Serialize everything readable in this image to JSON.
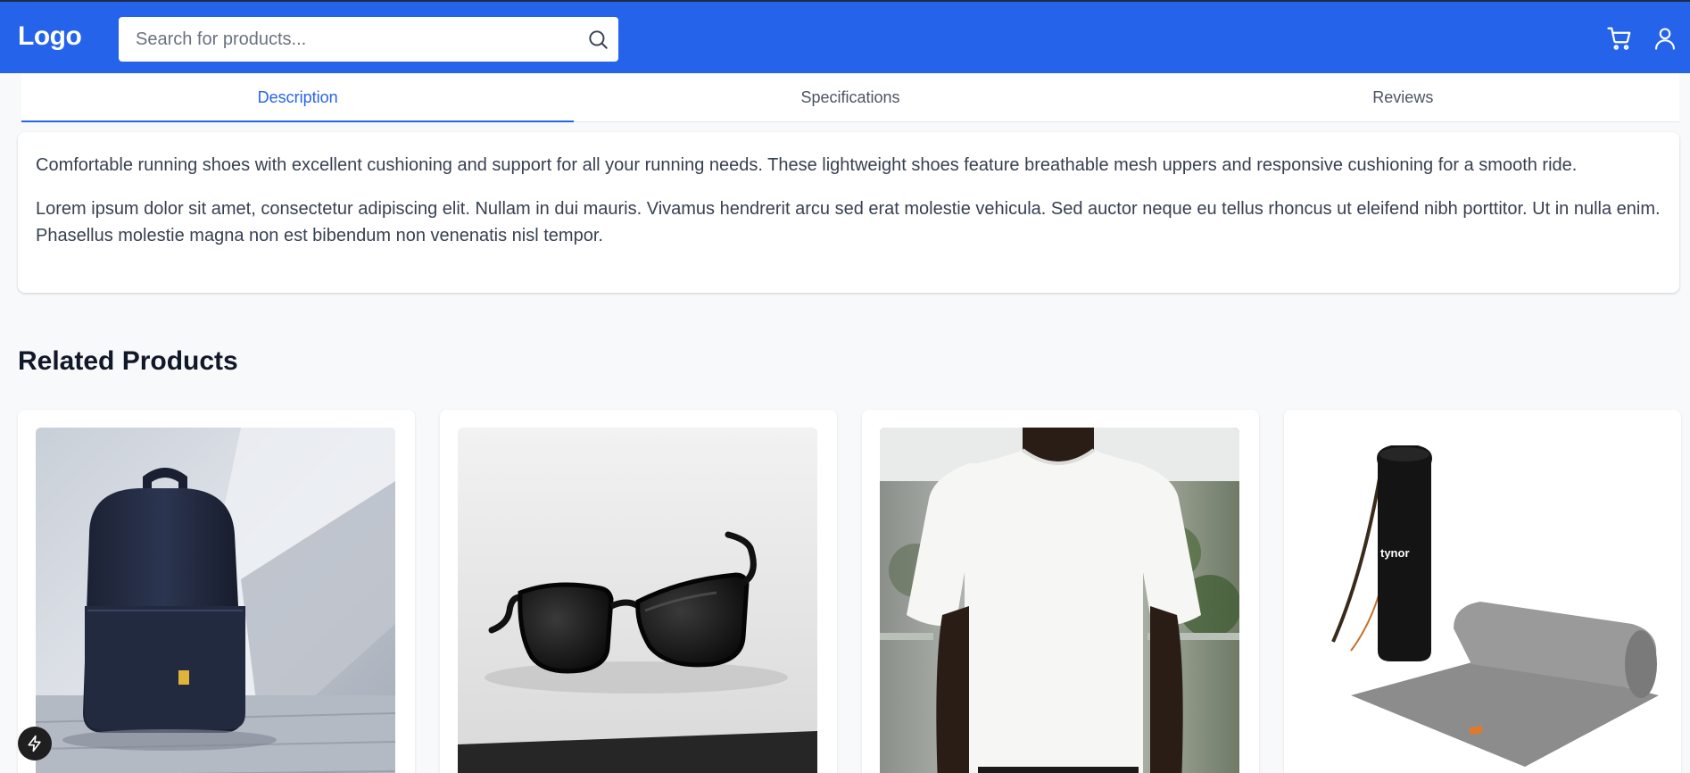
{
  "header": {
    "logo": "Logo",
    "search_placeholder": "Search for products...",
    "search_icon": "search-icon",
    "cart_icon": "cart-icon",
    "user_icon": "user-icon"
  },
  "tabs": [
    {
      "label": "Description",
      "active": true
    },
    {
      "label": "Specifications",
      "active": false
    },
    {
      "label": "Reviews",
      "active": false
    }
  ],
  "description": {
    "paragraphs": [
      "Comfortable running shoes with excellent cushioning and support for all your running needs. These lightweight shoes feature breathable mesh uppers and responsive cushioning for a smooth ride.",
      "Lorem ipsum dolor sit amet, consectetur adipiscing elit. Nullam in dui mauris. Vivamus hendrerit arcu sed erat molestie vehicula. Sed auctor neque eu tellus rhoncus ut eleifend nibh porttitor. Ut in nulla enim. Phasellus molestie magna non est bibendum non venenatis nisl tempor."
    ]
  },
  "related": {
    "title": "Related Products",
    "products": [
      {
        "image": "backpack-image"
      },
      {
        "image": "sunglasses-image"
      },
      {
        "image": "tshirt-image"
      },
      {
        "image": "yoga-mat-image",
        "brand_text": "tynor"
      }
    ]
  },
  "colors": {
    "brand": "#2563eb",
    "background": "#f8f9fb"
  },
  "floating_icon": "bolt-icon"
}
